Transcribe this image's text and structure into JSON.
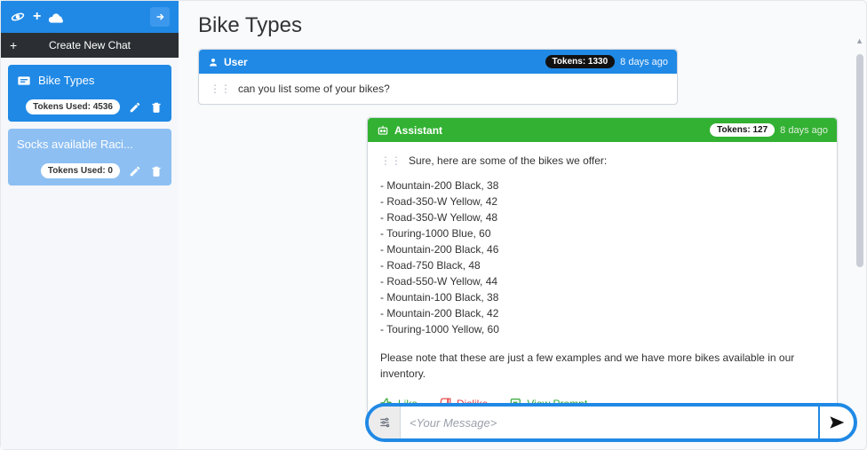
{
  "sidebar": {
    "new_chat_label": "Create New Chat",
    "chats": [
      {
        "title": "Bike Types",
        "tokens_label": "Tokens Used: 4536",
        "active": true
      },
      {
        "title": "Socks available Raci...",
        "tokens_label": "Tokens Used: 0",
        "active": false
      }
    ]
  },
  "page": {
    "title": "Bike Types"
  },
  "user_message": {
    "role_label": "User",
    "tokens_label": "Tokens: 1330",
    "time_label": "8 days ago",
    "text": "can you list some of your bikes?"
  },
  "assistant_message": {
    "role_label": "Assistant",
    "tokens_label": "Tokens: 127",
    "time_label": "8 days ago",
    "intro": "Sure, here are some of the bikes we offer:",
    "bikes": [
      "- Mountain-200 Black, 38",
      "- Road-350-W Yellow, 42",
      "- Road-350-W Yellow, 48",
      "- Touring-1000 Blue, 60",
      "- Mountain-200 Black, 46",
      "- Road-750 Black, 48",
      "- Road-550-W Yellow, 44",
      "- Mountain-100 Black, 38",
      "- Mountain-200 Black, 42",
      "- Touring-1000 Yellow, 60"
    ],
    "note": "Please note that these are just a few examples and we have more bikes available in our inventory.",
    "actions": {
      "like": "Like",
      "dislike": "Dislike",
      "view_prompt": "View Prompt"
    }
  },
  "composer": {
    "placeholder": "<Your Message>"
  },
  "colors": {
    "primary": "#2089e5",
    "assistant": "#32b132",
    "danger": "#e23b3b"
  }
}
